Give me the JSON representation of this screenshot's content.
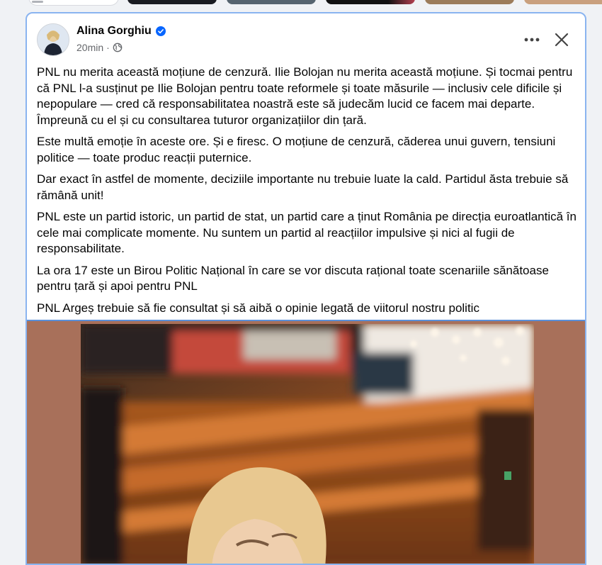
{
  "post": {
    "author": "Alina Gorghiu",
    "time": "20min",
    "separator": "·",
    "paragraphs": [
      "PNL nu merita această moțiune de cenzură. Ilie Bolojan nu merita această moțiune. Și tocmai pentru că PNL l-a susținut pe Ilie Bolojan pentru toate reformele și toate măsurile — inclusiv cele dificile și nepopulare — cred că responsabilitatea noastră este să judecăm lucid ce facem mai departe. Împreună cu el și cu consultarea tuturor organizațiilor din țară.",
      "Este multă emoție în aceste ore. Și e firesc. O moțiune de cenzură, căderea unui guvern, tensiuni politice — toate produc reacții puternice.",
      "Dar exact în astfel de momente, deciziile importante nu trebuie luate la cald. Partidul ăsta trebuie să rămână unit!",
      "PNL este un partid istoric, un partid de stat, un partid care a ținut România pe direcția euroatlantică în cele mai complicate momente. Nu suntem un partid al reacțiilor impulsive și nici al fugii de responsabilitate.",
      "La ora 17 este un Birou Politic Național în care se vor discuta rațional toate scenariile sănătoase pentru țară și apoi pentru PNL",
      "PNL Argeș trebuie să fie consultat și să aibă o opinie legată de viitorul nostru politic"
    ]
  },
  "icons": {
    "verified": "verified-badge-icon",
    "audience": "globe-icon",
    "more": "more-options-icon",
    "close": "close-icon"
  },
  "colors": {
    "verified_blue": "#0866ff",
    "focus_border": "#8ab4f0",
    "photo_frame": "#a8705a",
    "meta_gray": "#65676b"
  }
}
